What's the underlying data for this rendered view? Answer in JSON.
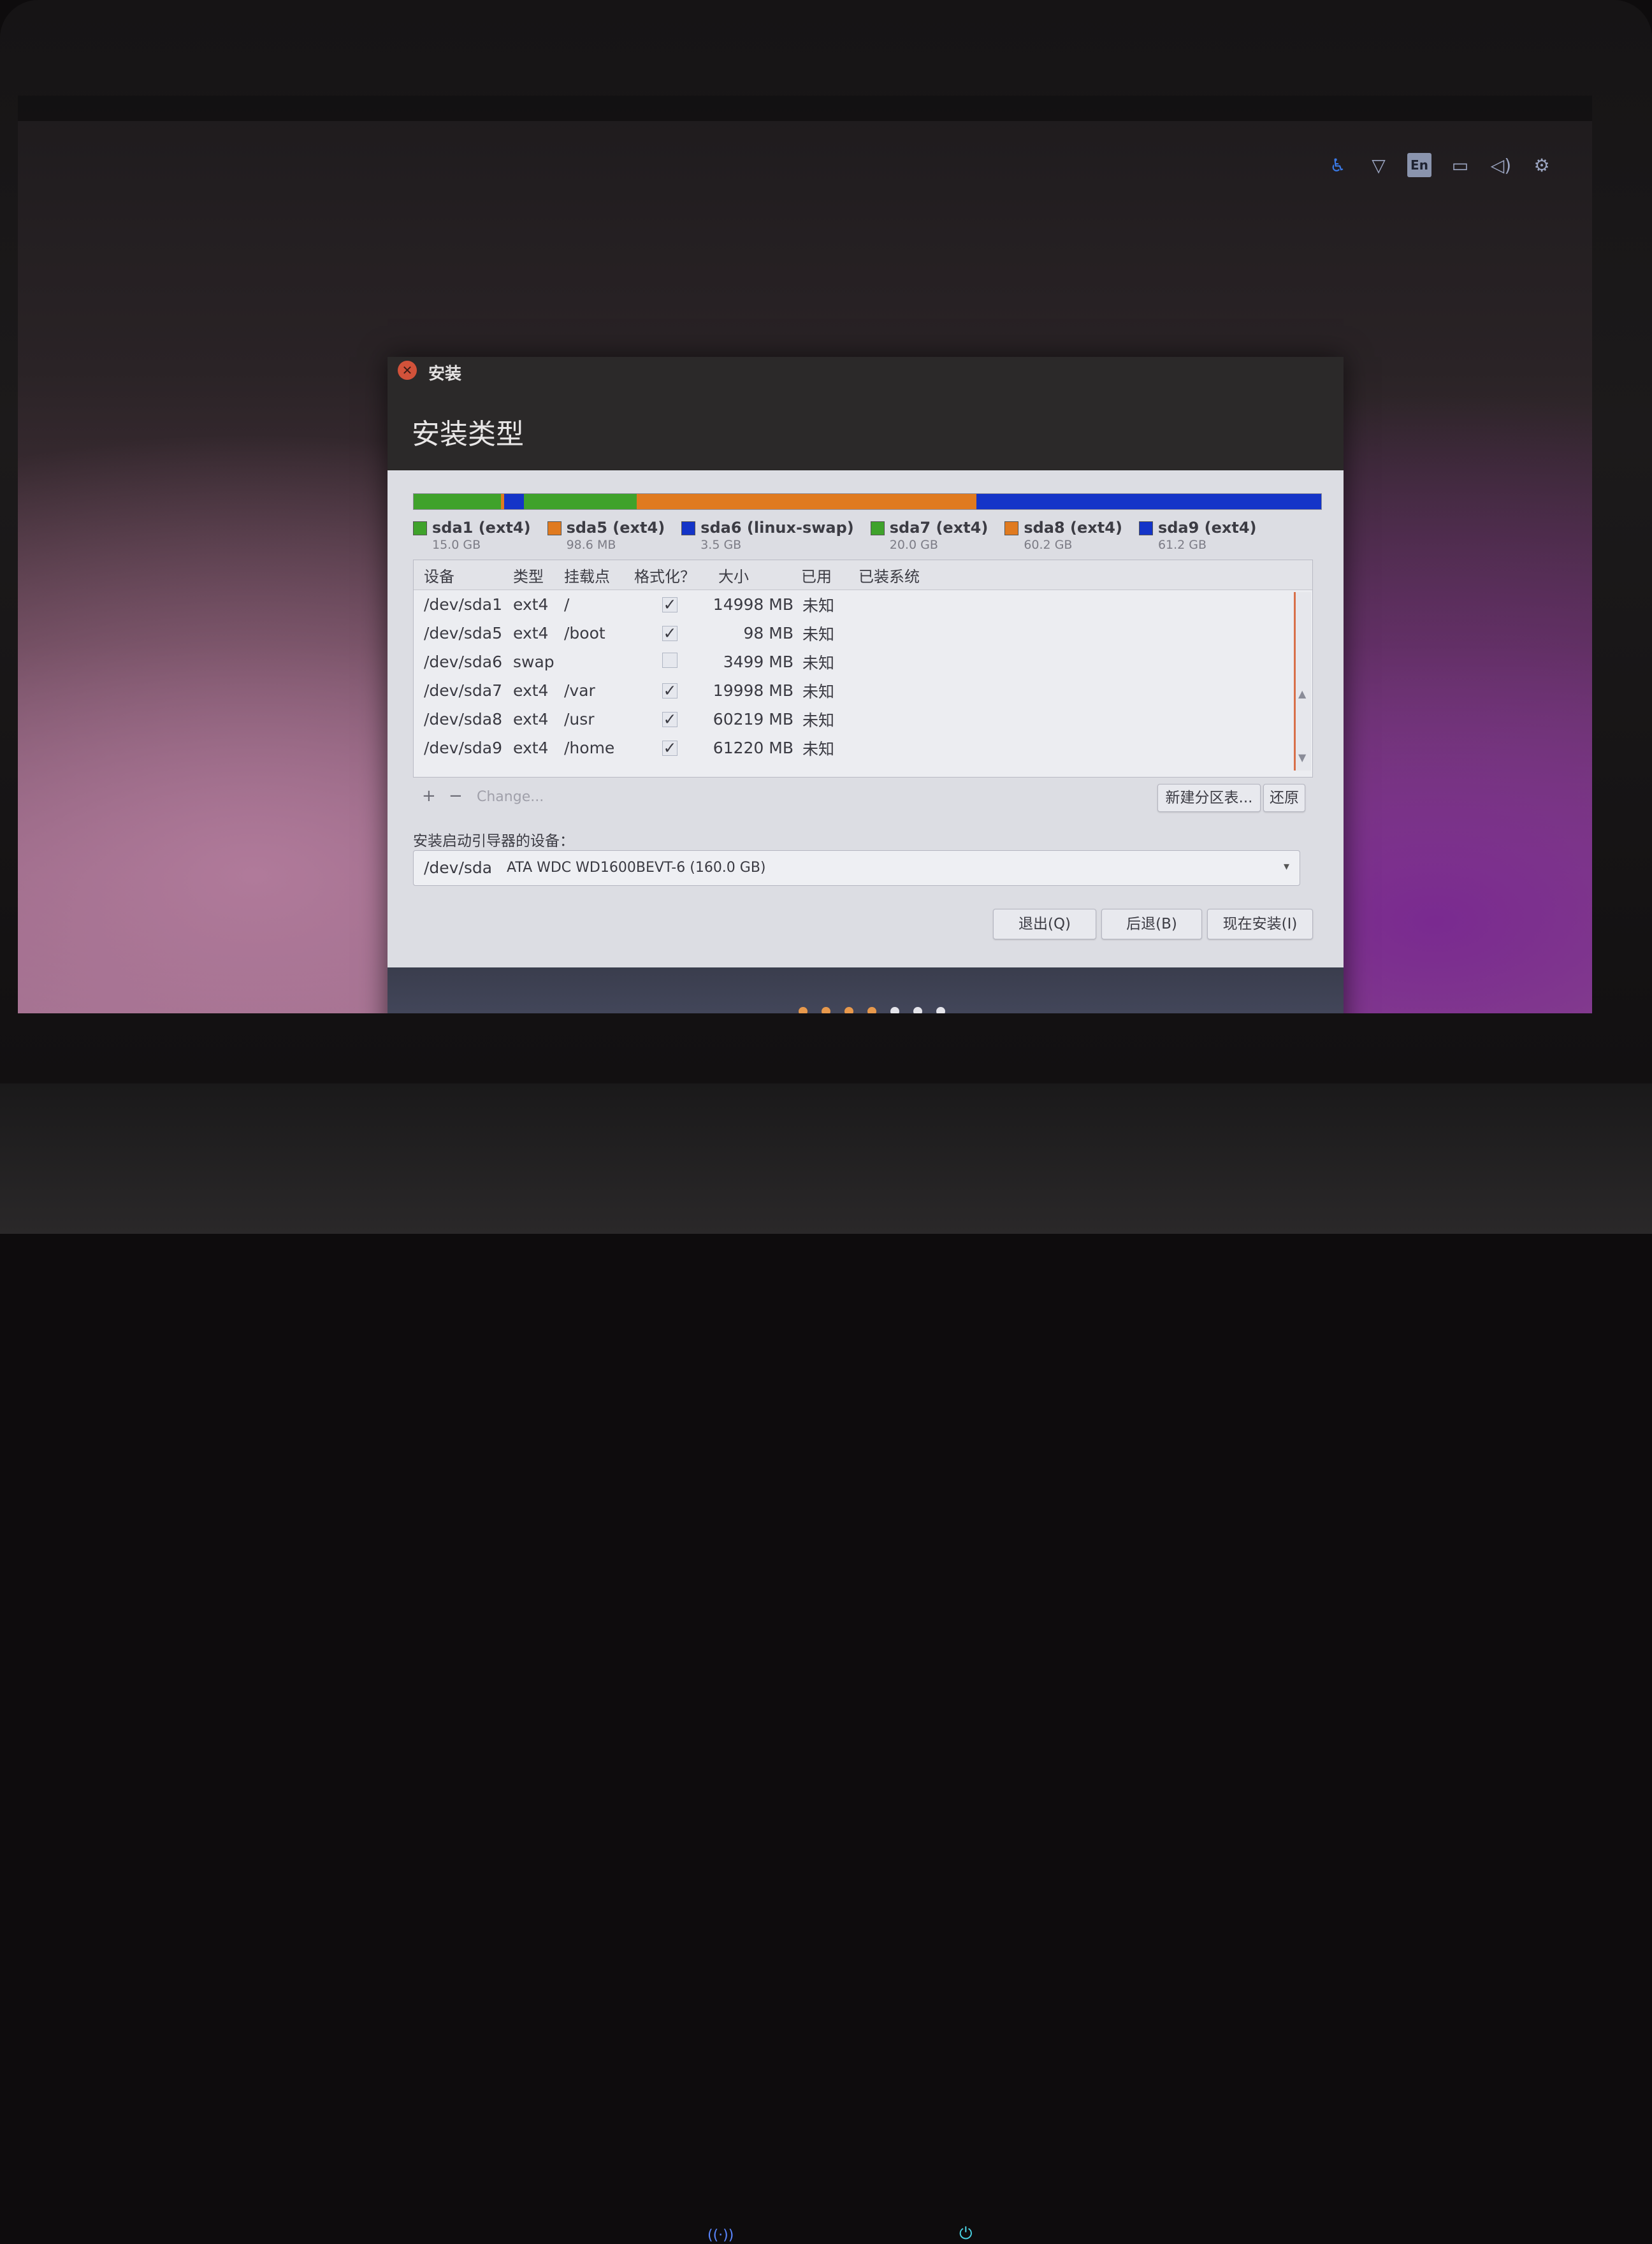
{
  "tray": {
    "icons": [
      "accessibility-icon",
      "wifi-icon",
      "keyboard-layout-icon",
      "battery-icon",
      "volume-icon",
      "settings-gear-icon"
    ],
    "language": "En"
  },
  "window": {
    "title": "安装",
    "heading": "安装类型"
  },
  "partition_bar": {
    "segments": [
      {
        "label": "sda1 (ext4)",
        "size": "15.0 GB",
        "color": "#3fa22b",
        "fraction": 0.097
      },
      {
        "label": "sda5 (ext4)",
        "size": "98.6 MB",
        "color": "#e07a1f",
        "fraction": 0.003
      },
      {
        "label": "sda6 (linux-swap)",
        "size": "3.5 GB",
        "color": "#1434c8",
        "fraction": 0.022
      },
      {
        "label": "sda7 (ext4)",
        "size": "20.0 GB",
        "color": "#3fa22b",
        "fraction": 0.125
      },
      {
        "label": "sda8 (ext4)",
        "size": "60.2 GB",
        "color": "#e07a1f",
        "fraction": 0.376
      },
      {
        "label": "sda9 (ext4)",
        "size": "61.2 GB",
        "color": "#1434c8",
        "fraction": 0.382
      }
    ]
  },
  "table": {
    "headers": {
      "device": "设备",
      "type": "类型",
      "mount": "挂载点",
      "format": "格式化？",
      "size": "大小",
      "used": "已用",
      "system": "已装系统"
    },
    "rows": [
      {
        "device": "/dev/sda1",
        "type": "ext4",
        "mount": "/",
        "format": true,
        "size": "14998 MB",
        "used": "未知"
      },
      {
        "device": "/dev/sda5",
        "type": "ext4",
        "mount": "/boot",
        "format": true,
        "size": "98 MB",
        "used": "未知"
      },
      {
        "device": "/dev/sda6",
        "type": "swap",
        "mount": "",
        "format": false,
        "size": "3499 MB",
        "used": "未知"
      },
      {
        "device": "/dev/sda7",
        "type": "ext4",
        "mount": "/var",
        "format": true,
        "size": "19998 MB",
        "used": "未知"
      },
      {
        "device": "/dev/sda8",
        "type": "ext4",
        "mount": "/usr",
        "format": true,
        "size": "60219 MB",
        "used": "未知"
      },
      {
        "device": "/dev/sda9",
        "type": "ext4",
        "mount": "/home",
        "format": true,
        "size": "61220 MB",
        "used": "未知"
      }
    ]
  },
  "toolbar": {
    "add": "+",
    "remove": "−",
    "change": "Change...",
    "new_table": "新建分区表...",
    "revert": "还原"
  },
  "bootloader": {
    "label": "安装启动引导器的设备：",
    "device": "/dev/sda",
    "description": "ATA WDC WD1600BEVT-6 (160.0 GB)"
  },
  "buttons": {
    "quit": "退出(Q)",
    "back": "后退(B)",
    "install_now": "现在安装(I)"
  },
  "progress": {
    "steps_total": 7,
    "steps_done": 4
  }
}
